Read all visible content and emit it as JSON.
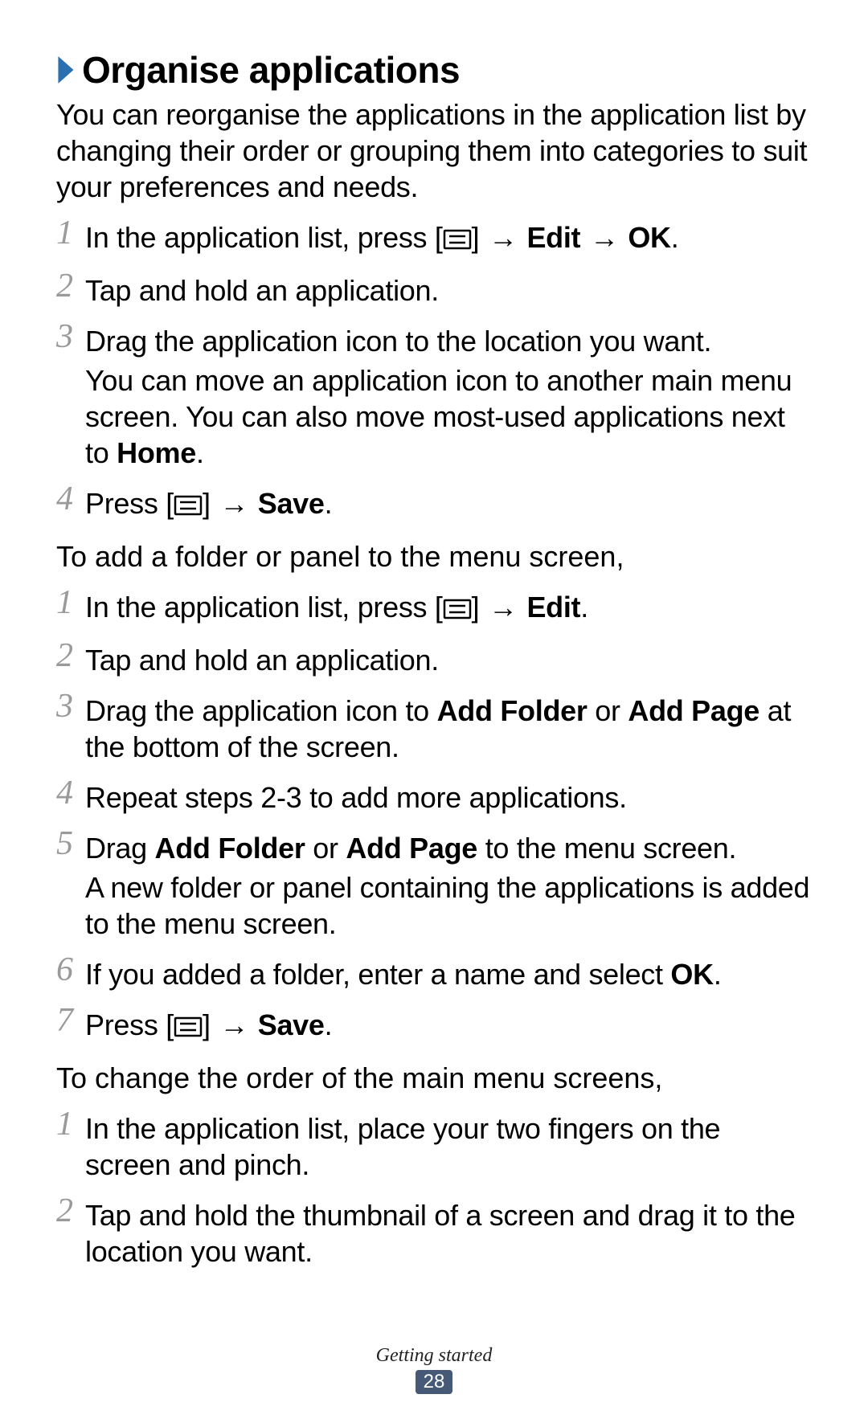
{
  "heading": "Organise applications",
  "intro": "You can reorganise the applications in the application list by changing their order or grouping them into categories to suit your preferences and needs.",
  "arrow": "→",
  "listA": {
    "1": {
      "pre": "In the application list, press [",
      "post": "] ",
      "b1": "Edit",
      "b2": "OK",
      "tail": "."
    },
    "2": "Tap and hold an application.",
    "3": {
      "line1": "Drag the application icon to the location you want.",
      "line2a": "You can move an application icon to another main menu screen. You can also move most-used applications next to ",
      "line2b": "Home",
      "line2c": "."
    },
    "4": {
      "pre": "Press [",
      "post": "] ",
      "b1": "Save",
      "tail": "."
    }
  },
  "sub1": "To add a folder or panel to the menu screen,",
  "listB": {
    "1": {
      "pre": "In the application list, press [",
      "post": "] ",
      "b1": "Edit",
      "tail": "."
    },
    "2": "Tap and hold an application.",
    "3": {
      "a": "Drag the application icon to ",
      "b1": "Add Folder",
      "mid": " or ",
      "b2": "Add Page",
      "tail": " at the bottom of the screen."
    },
    "4": "Repeat steps 2-3 to add more applications.",
    "5": {
      "a": "Drag ",
      "b1": "Add Folder",
      "mid": " or ",
      "b2": "Add Page",
      "tail": " to the menu screen.",
      "line2": "A new folder or panel containing the applications is added to the menu screen."
    },
    "6": {
      "a": "If you added a folder, enter a name and select ",
      "b1": "OK",
      "tail": "."
    },
    "7": {
      "pre": "Press [",
      "post": "] ",
      "b1": "Save",
      "tail": "."
    }
  },
  "sub2": "To change the order of the main menu screens,",
  "listC": {
    "1": "In the application list, place your two fingers on the screen and pinch.",
    "2": "Tap and hold the thumbnail of a screen and drag it to the location you want."
  },
  "footer": {
    "section": "Getting started",
    "page": "28"
  }
}
